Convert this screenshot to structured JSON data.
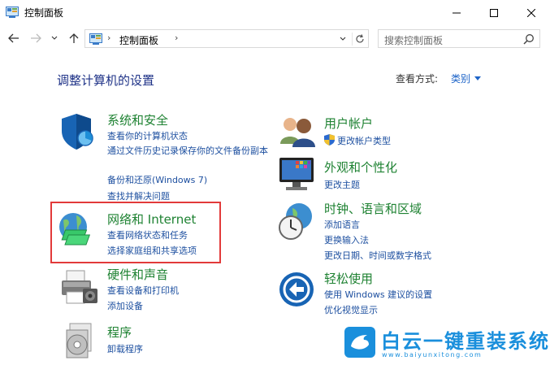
{
  "window": {
    "title": "控制面板"
  },
  "address": {
    "path": "控制面板",
    "search_placeholder": "搜索控制面板"
  },
  "main": {
    "heading": "调整计算机的设置",
    "view_by_label": "查看方式:",
    "view_by_value": "类别"
  },
  "categories": {
    "security": {
      "title": "系统和安全",
      "links": [
        "查看你的计算机状态",
        "通过文件历史记录保存你的文件备份副本",
        "备份和还原(Windows 7)",
        "查找并解决问题"
      ]
    },
    "network": {
      "title": "网络和 Internet",
      "links": [
        "查看网络状态和任务",
        "选择家庭组和共享选项"
      ]
    },
    "hardware": {
      "title": "硬件和声音",
      "links": [
        "查看设备和打印机",
        "添加设备"
      ]
    },
    "programs": {
      "title": "程序",
      "links": [
        "卸载程序"
      ]
    },
    "accounts": {
      "title": "用户帐户",
      "links": [
        "更改帐户类型"
      ]
    },
    "appearance": {
      "title": "外观和个性化",
      "links": [
        "更改主题"
      ]
    },
    "clock": {
      "title": "时钟、语言和区域",
      "links": [
        "添加语言",
        "更换输入法",
        "更改日期、时间或数字格式"
      ]
    },
    "ease": {
      "title": "轻松使用",
      "links": [
        "使用 Windows 建议的设置",
        "优化视觉显示"
      ]
    }
  },
  "watermark": {
    "text": "白云一键重装系统",
    "url": "www.baiyunxitong.com"
  },
  "colors": {
    "title_green": "#1e8232",
    "link_blue": "#1e50a0",
    "highlight_red": "#e23a3a",
    "watermark_blue": "#1a8fdc"
  }
}
